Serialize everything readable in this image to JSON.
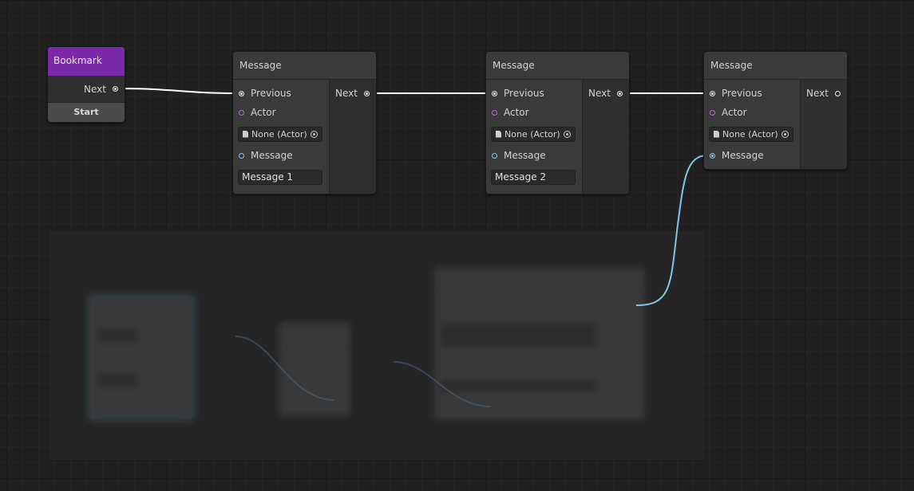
{
  "bookmark": {
    "title": "Bookmark",
    "next_label": "Next",
    "start_label": "Start"
  },
  "nodes": [
    {
      "title": "Message",
      "inputs": {
        "previous": "Previous",
        "actor": "Actor",
        "message": "Message"
      },
      "actor_value": "None (Actor)",
      "message_value": "Message 1",
      "output": "Next"
    },
    {
      "title": "Message",
      "inputs": {
        "previous": "Previous",
        "actor": "Actor",
        "message": "Message"
      },
      "actor_value": "None (Actor)",
      "message_value": "Message 2",
      "output": "Next"
    },
    {
      "title": "Message",
      "inputs": {
        "previous": "Previous",
        "actor": "Actor",
        "message": "Message"
      },
      "actor_value": "None (Actor)",
      "output": "Next"
    }
  ],
  "colors": {
    "background": "#202020",
    "node": "#3a3a3a",
    "bookmark_header": "#7a2aa8",
    "flow_wire": "#ffffff",
    "string_wire": "#7fc7e8",
    "actor_port": "#c26bd6"
  }
}
